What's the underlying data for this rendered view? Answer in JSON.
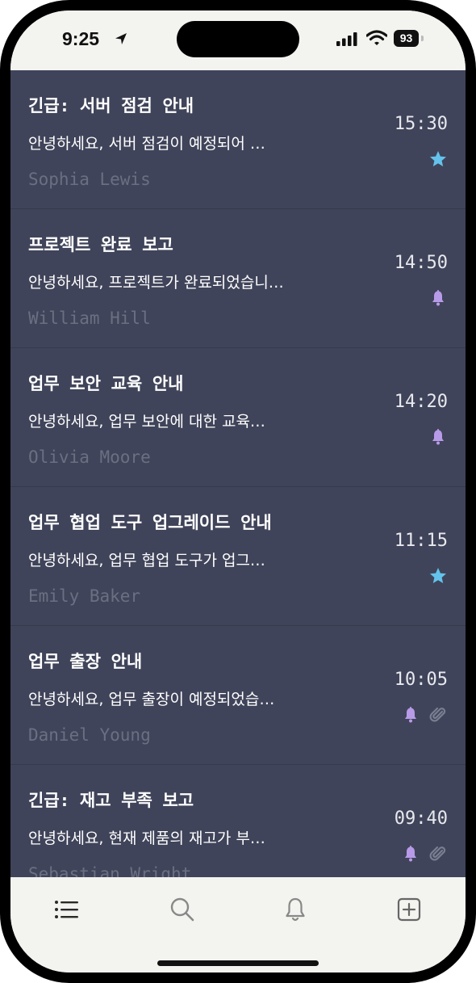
{
  "status_bar": {
    "time": "9:25",
    "battery": "93"
  },
  "colors": {
    "star": "#64c3ec",
    "bell": "#b89be8",
    "attachment": "#7a7e91",
    "list_bg": "#40445a"
  },
  "emails": [
    {
      "subject": "긴급: 서버 점검 안내",
      "preview": "안녕하세요, 서버 점검이 예정되어 …",
      "sender": "Sophia Lewis",
      "time": "15:30",
      "icons": [
        "star-icon"
      ]
    },
    {
      "subject": "프로젝트 완료 보고",
      "preview": "안녕하세요, 프로젝트가 완료되었습니…",
      "sender": "William Hill",
      "time": "14:50",
      "icons": [
        "bell-icon"
      ]
    },
    {
      "subject": "업무 보안 교육 안내",
      "preview": "안녕하세요, 업무 보안에 대한 교육…",
      "sender": "Olivia Moore",
      "time": "14:20",
      "icons": [
        "bell-icon"
      ]
    },
    {
      "subject": "업무 협업 도구 업그레이드 안내",
      "preview": "안녕하세요, 업무 협업 도구가 업그…",
      "sender": "Emily Baker",
      "time": "11:15",
      "icons": [
        "star-icon"
      ]
    },
    {
      "subject": "업무 출장 안내",
      "preview": "안녕하세요, 업무 출장이 예정되었습…",
      "sender": "Daniel Young",
      "time": "10:05",
      "icons": [
        "bell-icon",
        "paperclip-icon"
      ]
    },
    {
      "subject": "긴급: 재고 부족 보고",
      "preview": "안녕하세요, 현재 제품의 재고가 부…",
      "sender": "Sebastian Wright",
      "time": "09:40",
      "icons": [
        "bell-icon",
        "paperclip-icon"
      ]
    }
  ],
  "tab_bar": {
    "tabs": [
      "list-icon",
      "search-icon",
      "bell-icon",
      "compose-icon"
    ]
  }
}
